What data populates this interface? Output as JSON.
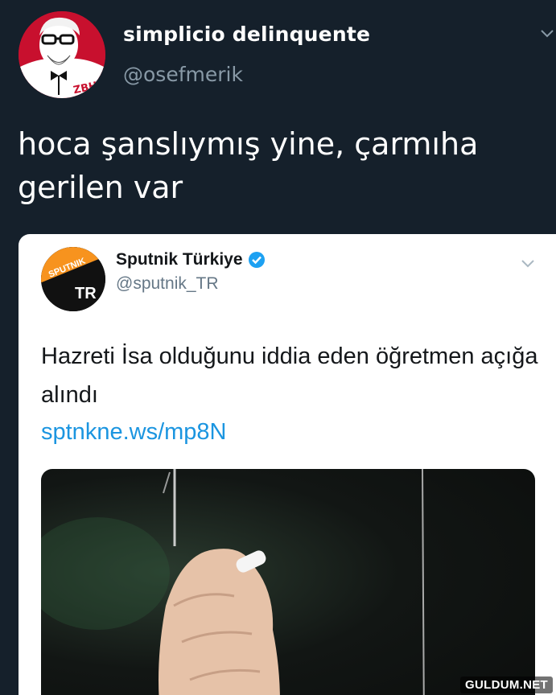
{
  "tweet": {
    "display_name": "simplicio delinquente",
    "handle": "@osefmerik",
    "text": "hoca şanslıymış yine, çarmıha gerilen var",
    "avatar_text": "ZBH"
  },
  "quoted_tweet": {
    "display_name": "Sputnik Türkiye",
    "handle": "@sputnik_TR",
    "verified": true,
    "text": "Hazreti İsa olduğunu iddia eden öğretmen açığa alındı",
    "link": "sptnkne.ws/mp8N",
    "avatar_labels": {
      "top": "SPUTNIK",
      "bottom": "TR"
    }
  },
  "watermark": "GULDUM.NET",
  "colors": {
    "background": "#15202b",
    "card": "#ffffff",
    "link": "#1b95e0",
    "verified": "#1da1f2",
    "muted": "#8899a6",
    "sputnik_orange": "#f7931e"
  },
  "icons": [
    "chevron-down-icon",
    "verified-badge-icon"
  ]
}
